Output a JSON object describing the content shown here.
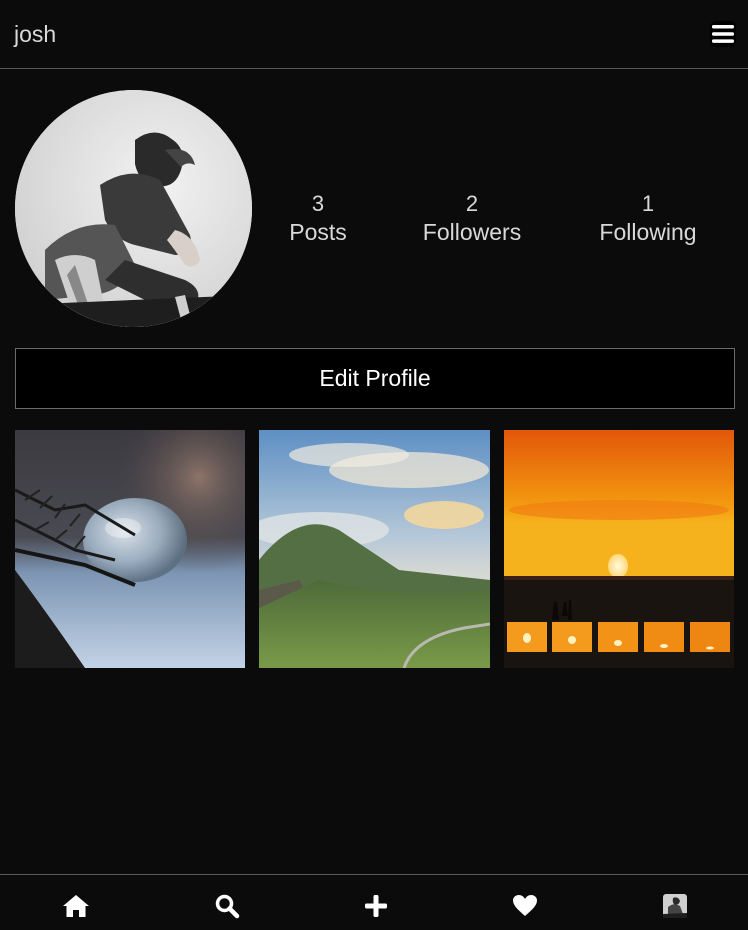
{
  "header": {
    "username": "josh",
    "menu_icon": "hamburger-menu-icon"
  },
  "profile": {
    "avatar_alt": "profile photo",
    "stats": [
      {
        "value": "3",
        "label": "Posts"
      },
      {
        "value": "2",
        "label": "Followers"
      },
      {
        "value": "1",
        "label": "Following"
      }
    ],
    "edit_label": "Edit Profile"
  },
  "posts": [
    {
      "description": "frozen bubble on pine branch"
    },
    {
      "description": "green mountain valley with clouds"
    },
    {
      "description": "orange sunset over desert"
    }
  ],
  "bottom_nav": {
    "items": [
      "home-icon",
      "search-icon",
      "plus-icon",
      "heart-icon",
      "profile-avatar-icon"
    ]
  },
  "colors": {
    "background": "#0b0b0b",
    "text": "#d9d9d9",
    "divider": "#5a5a5a"
  }
}
